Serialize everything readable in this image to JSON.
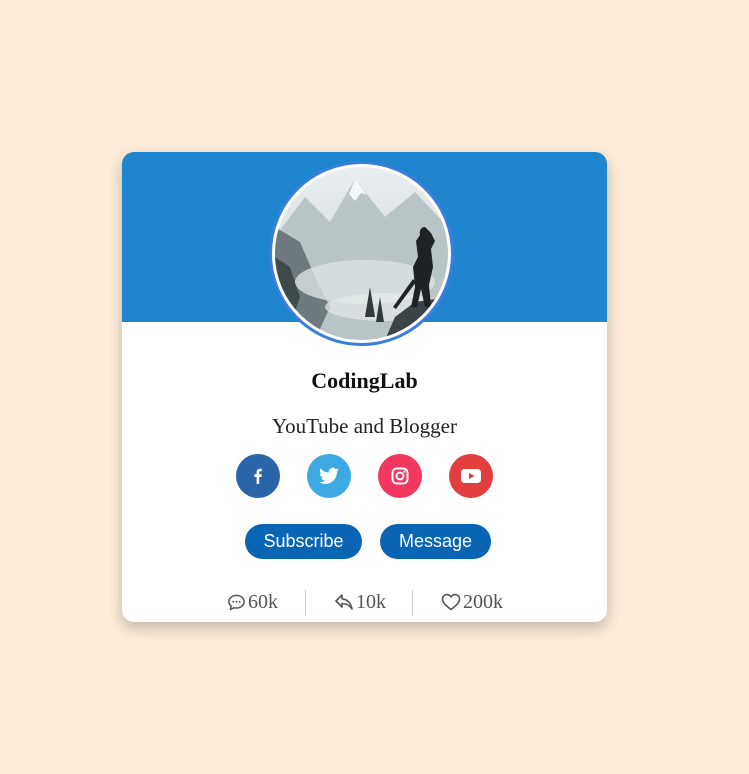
{
  "profile": {
    "name": "CodingLab",
    "job": "YouTube and Blogger",
    "avatar_icon": "avatar-image"
  },
  "social": [
    {
      "name": "facebook",
      "icon": "facebook-icon",
      "color": "#2A65A8"
    },
    {
      "name": "twitter",
      "icon": "twitter-icon",
      "color": "#3DA9E2"
    },
    {
      "name": "instagram",
      "icon": "instagram-icon",
      "color": "#F2385E"
    },
    {
      "name": "youtube",
      "icon": "youtube-icon",
      "color": "#E23E3E"
    }
  ],
  "buttons": {
    "subscribe": "Subscribe",
    "message": "Message"
  },
  "stats": {
    "comments": "60k",
    "shares": "10k",
    "likes": "200k"
  },
  "colors": {
    "page_background": "#FBEBD8",
    "banner": "#1F85CE",
    "button": "#0A66B5",
    "avatar_border": "#3A7FE0"
  }
}
